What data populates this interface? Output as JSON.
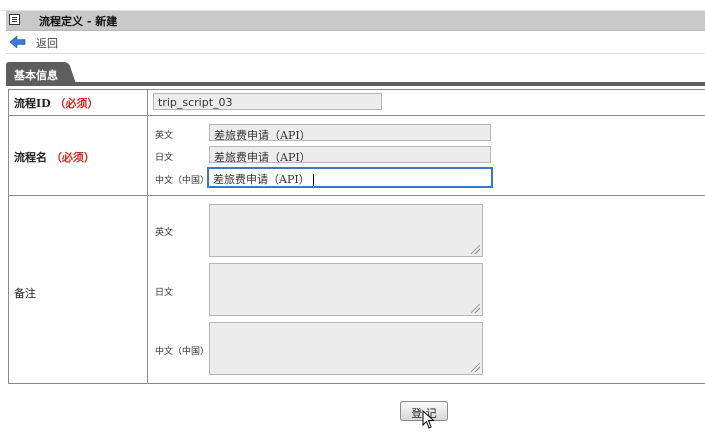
{
  "window": {
    "title": "流程定义 - 新建",
    "title_icon": "document-icon"
  },
  "nav": {
    "back_label": "返回",
    "back_icon": "back-arrow-icon"
  },
  "tab": {
    "label": "基本信息"
  },
  "form": {
    "flow_id": {
      "label": "流程ID",
      "required": "（必须）",
      "value": "trip_script_03"
    },
    "flow_name": {
      "label": "流程名",
      "required": "（必须）",
      "langs": [
        {
          "lang": "英文",
          "value": "差旅费申请（API）"
        },
        {
          "lang": "日文",
          "value": "差旅费申请（API）"
        },
        {
          "lang": "中文（中国）",
          "value": "差旅费申请（API）"
        }
      ]
    },
    "remarks": {
      "label": "备注",
      "langs": [
        {
          "lang": "英文",
          "value": ""
        },
        {
          "lang": "日文",
          "value": ""
        },
        {
          "lang": "中文（中国）",
          "value": ""
        }
      ]
    }
  },
  "actions": {
    "submit_label": "登 记"
  },
  "colors": {
    "required": "#d0281c",
    "focus_border": "#3b78c4",
    "tab_bg": "#5d5d5d"
  }
}
